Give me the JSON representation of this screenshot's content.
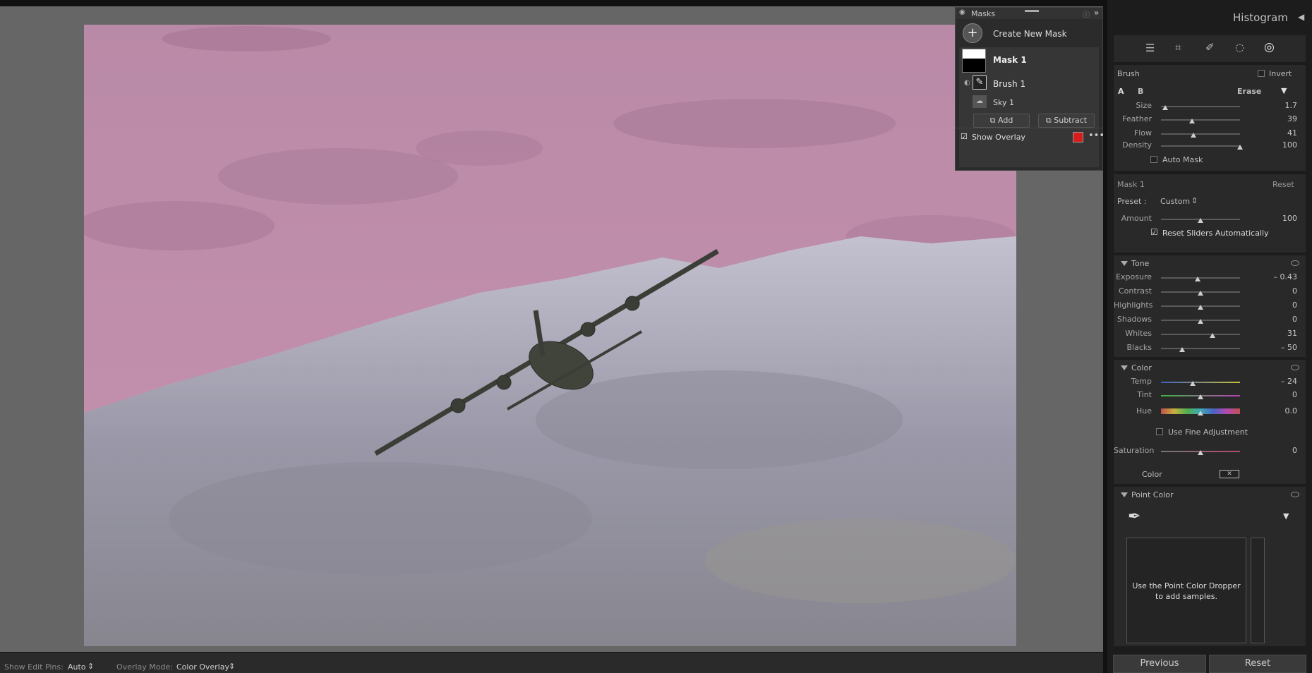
{
  "bottombar": {
    "show_edit_pins_label": "Show Edit Pins:",
    "show_edit_pins_value": "Auto",
    "overlay_mode_label": "Overlay Mode:",
    "overlay_mode_value": "Color Overlay"
  },
  "masks_panel": {
    "title": "Masks",
    "create_new_mask": "Create New Mask",
    "mask1": "Mask 1",
    "brush1": "Brush 1",
    "sky1": "Sky 1",
    "add": "Add",
    "subtract": "Subtract",
    "show_overlay": "Show Overlay",
    "overlay_color": "#d81c1c"
  },
  "right": {
    "histogram": "Histogram",
    "brush": {
      "label": "Brush",
      "invert": "Invert",
      "a": "A",
      "b": "B",
      "erase": "Erase",
      "size_label": "Size",
      "size_value": "1.7",
      "size_pos": 0.05,
      "feather_label": "Feather",
      "feather_value": "39",
      "feather_pos": 0.39,
      "flow_label": "Flow",
      "flow_value": "41",
      "flow_pos": 0.41,
      "density_label": "Density",
      "density_value": "100",
      "density_pos": 1.0,
      "automask": "Auto Mask"
    },
    "mask": {
      "title": "Mask 1",
      "reset": "Reset",
      "preset_label": "Preset :",
      "preset_value": "Custom",
      "amount_label": "Amount",
      "amount_value": "100",
      "amount_pos": 0.5,
      "reset_sliders": "Reset Sliders Automatically"
    },
    "tone": {
      "title": "Tone",
      "rows": [
        {
          "label": "Exposure",
          "value": "– 0.43",
          "pos": 0.46
        },
        {
          "label": "Contrast",
          "value": "0",
          "pos": 0.5
        },
        {
          "label": "Highlights",
          "value": "0",
          "pos": 0.5
        },
        {
          "label": "Shadows",
          "value": "0",
          "pos": 0.5
        },
        {
          "label": "Whites",
          "value": "31",
          "pos": 0.65
        },
        {
          "label": "Blacks",
          "value": "– 50",
          "pos": 0.27
        }
      ]
    },
    "color": {
      "title": "Color",
      "temp_label": "Temp",
      "temp_value": "– 24",
      "temp_pos": 0.4,
      "tint_label": "Tint",
      "tint_value": "0",
      "tint_pos": 0.5,
      "hue_label": "Hue",
      "hue_value": "0.0",
      "hue_pos": 0.5,
      "fine": "Use Fine Adjustment",
      "sat_label": "Saturation",
      "sat_value": "0",
      "sat_pos": 0.5,
      "color_label": "Color"
    },
    "point_color": {
      "title": "Point Color",
      "hint1": "Use the Point Color Dropper",
      "hint2": "to add samples."
    },
    "previous": "Previous",
    "reset": "Reset"
  }
}
